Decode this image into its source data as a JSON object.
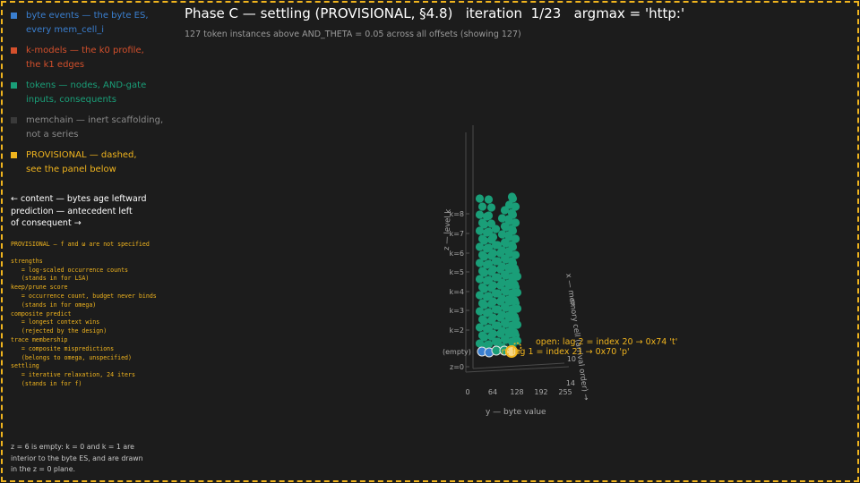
{
  "colors": {
    "background": "#1c1c1c",
    "frame": "#f0b41e",
    "byte_events": "#3a7fd0",
    "k_models": "#d4502c",
    "tokens": "#1a9e78",
    "memchain": "#3a3a3a",
    "provisional": "#f0b41e"
  },
  "legend": [
    {
      "color": "#3a7fd0",
      "line1": "byte events — the byte ES,",
      "line2": "every mem_cell_i"
    },
    {
      "color": "#d4502c",
      "line1": "k-models — the k0 profile,",
      "line2": "the k1 edges"
    },
    {
      "color": "#1a9e78",
      "line1": "tokens — nodes, AND-gate",
      "line2": "inputs, consequents"
    },
    {
      "color": "#3a3a3a",
      "line1": "memchain — inert scaffolding,",
      "line2": "not a series"
    },
    {
      "color": "#f0b41e",
      "line1": "PROVISIONAL — dashed,",
      "line2": "see the panel below"
    }
  ],
  "reading": {
    "line1": "←  content — bytes age leftward",
    "line2": "prediction — antecedent left",
    "line3": "of consequent  →"
  },
  "provisional_panel": {
    "heading": "PROVISIONAL — f and ω are not specified",
    "lines": [
      "strengths",
      "   = log-scaled occurrence counts",
      "   (stands in for LSA)",
      "keep/prune score",
      "   = occurrence count, budget never binds",
      "   (stands in for omega)",
      "composite predict",
      "   = longest context wins",
      "   (rejected by the design)",
      "trace membership",
      "   = composite mispredictions",
      "   (belongs to omega, unspecified)",
      "settling",
      "   = iterative relaxation, 24 iters",
      "   (stands in for f)"
    ]
  },
  "note": {
    "line1": "z = 6 is empty: k = 0 and k = 1 are",
    "line2": "interior to the byte ES, and are drawn",
    "line3": "in the z = 0 plane."
  },
  "header": {
    "title": "Phase C — settling (PROVISIONAL, §4.8)   iteration  1/23   argmax = 'http:'",
    "subtitle": "127 token instances above AND_THETA = 0.05 across all offsets (showing 127)"
  },
  "chart_data": {
    "type": "scatter",
    "z_ticks": [
      "z=0",
      "k=2",
      "k=3",
      "k=4",
      "k=5",
      "k=6",
      "k=7",
      "k=8"
    ],
    "y_ticks": [
      "0",
      "64",
      "128",
      "192",
      "255"
    ],
    "y_label": "y — byte value",
    "z_label": "z — level k",
    "x_label": "x — memory cell (arrival order) →",
    "x_ticks": [
      "0",
      "10",
      "14"
    ],
    "empty_label": "(empty)",
    "annotations": [
      "open: lag 2 = index 20 → 0x74 't'",
      "open: lag 1 = index 21 → 0x70 'p'"
    ]
  }
}
